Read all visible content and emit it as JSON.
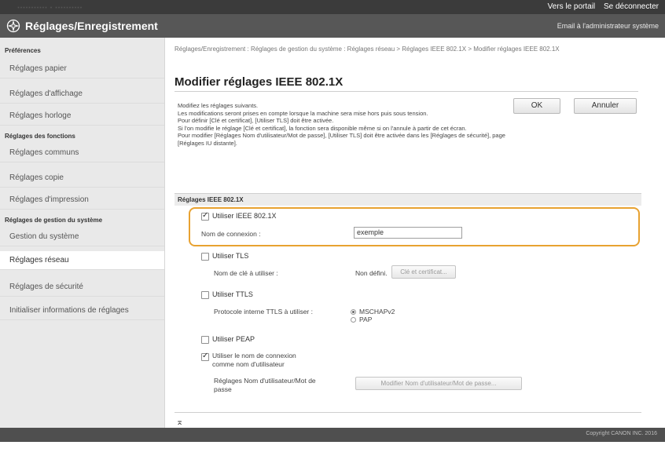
{
  "topbar": {
    "model": "··········· · ··········",
    "links": [
      "Vers le portail",
      "Se déconnecter"
    ]
  },
  "header": {
    "title": "Réglages/Enregistrement",
    "email_link": "Email à l'administrateur système"
  },
  "sidebar": {
    "group1": "Préférences",
    "group1_items": [
      "Réglages papier",
      "Réglages d'affichage",
      "Réglages horloge"
    ],
    "group2": "Réglages des fonctions",
    "group2_items": [
      "Réglages communs",
      "Réglages copie",
      "Réglages d'impression"
    ],
    "group3": "Réglages de gestion du système",
    "group3_items": [
      "Gestion du système",
      "Réglages réseau",
      "Réglages de sécurité",
      "Initialiser informations de réglages"
    ]
  },
  "breadcrumb": "Réglages/Enregistrement : Réglages de gestion du système : Réglages réseau > Réglages IEEE 802.1X > Modifier réglages IEEE 802.1X",
  "page_title": "Modifier réglages IEEE 802.1X",
  "buttons": {
    "ok": "OK",
    "cancel": "Annuler"
  },
  "intro": [
    "Modifiez les réglages suivants.",
    "Les modifications seront prises en compte lorsque la machine sera mise hors puis sous tension.",
    "Pour définir [Clé et certificat], [Utiliser TLS] doit être activée.",
    "Si l'on modifie le réglage [Clé et certificat], la fonction sera disponible même si on l'annule à partir de cet écran.",
    "Pour modifier [Réglages Nom d'utilisateur/Mot de passe], [Utiliser TLS] doit être activée dans les [Réglages de sécurité], page [Réglages IU distante]."
  ],
  "section": {
    "heading": "Réglages IEEE 802.1X",
    "use_ieee_label": "Utiliser IEEE 802.1X",
    "login_name_label": "Nom de connexion :",
    "login_name_value": "exemple",
    "use_tls_label": "Utiliser TLS",
    "key_name_label": "Nom de clé à utiliser :",
    "key_name_value": "Non défini.",
    "key_cert_button": "Clé et certificat...",
    "use_ttls_label": "Utiliser TTLS",
    "ttls_protocol_label": "Protocole interne TTLS à utiliser :",
    "radio_mschap": "MSCHAPv2",
    "radio_pap": "PAP",
    "use_peap_label": "Utiliser PEAP",
    "use_login_as_user_label": "Utiliser le nom de connexion comme nom d'utilisateur",
    "userpass_label": "Réglages Nom d'utilisateur/Mot de passe",
    "userpass_button": "Modifier Nom d'utilisateur/Mot de passe..."
  },
  "top_link": "⌅",
  "footer": {
    "copyright": "Copyright CANON INC. 2016"
  }
}
